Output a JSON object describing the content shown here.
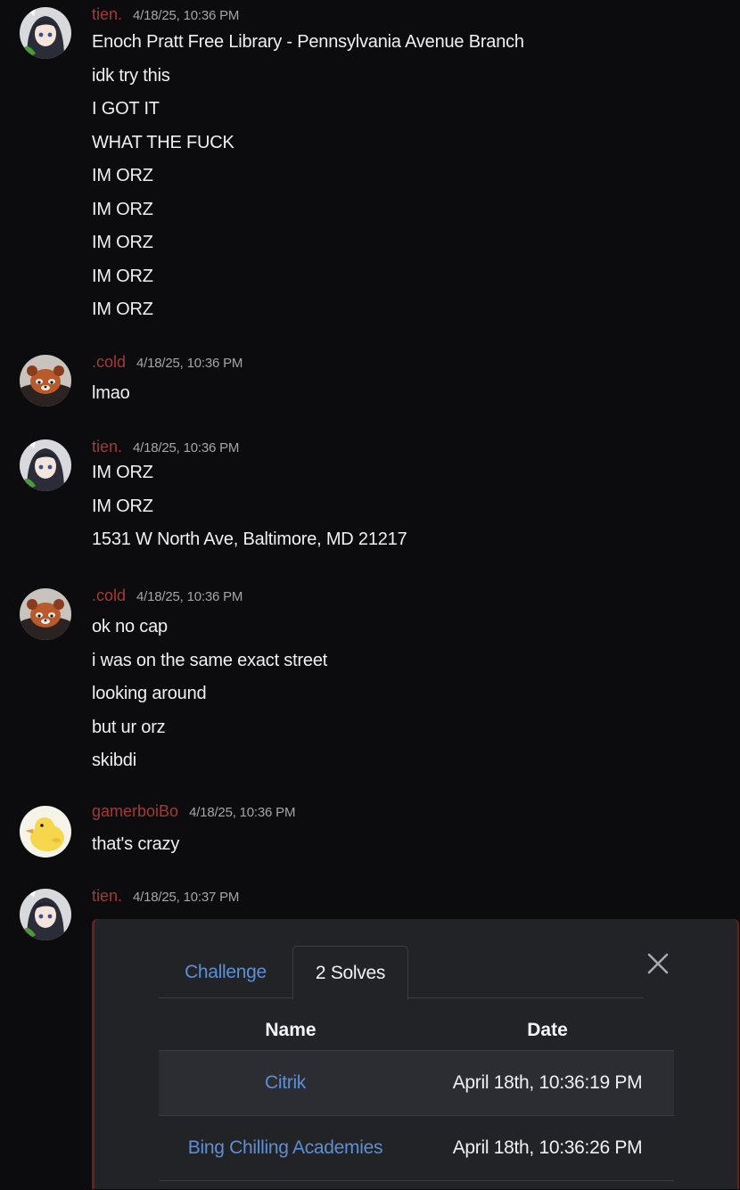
{
  "messages": [
    {
      "user": "tien.",
      "time": "4/18/25, 10:36 PM",
      "avatar": "anime-girl-avatar",
      "lines": [
        "Enoch Pratt Free Library - Pennsylvania Avenue Branch",
        "idk try this",
        "I GOT IT",
        "WHAT THE FUCK",
        "IM ORZ",
        "IM ORZ",
        "IM ORZ",
        "IM ORZ",
        "IM ORZ"
      ]
    },
    {
      "user": ".cold",
      "time": "4/18/25, 10:36 PM",
      "avatar": "red-panda-avatar",
      "lines": [
        "lmao"
      ]
    },
    {
      "user": "tien.",
      "time": "4/18/25, 10:36 PM",
      "avatar": "anime-girl-avatar",
      "lines": [
        "IM ORZ",
        "IM ORZ",
        "1531 W North Ave, Baltimore, MD 21217"
      ]
    },
    {
      "user": ".cold",
      "time": "4/18/25, 10:36 PM",
      "avatar": "red-panda-avatar",
      "lines": [
        "ok no cap",
        "i was on the same exact street",
        "looking around",
        "but ur orz",
        "skibdi"
      ]
    },
    {
      "user": "gamerboiBo",
      "time": "4/18/25, 10:36 PM",
      "avatar": "duck-avatar",
      "lines": [
        "that's crazy"
      ]
    },
    {
      "user": "tien.",
      "time": "4/18/25, 10:37 PM",
      "avatar": "anime-girl-avatar",
      "lines": []
    }
  ],
  "modal": {
    "tabs": [
      {
        "label": "Challenge",
        "active": false
      },
      {
        "label": "2 Solves",
        "active": true
      }
    ],
    "close_icon": "close-icon",
    "columns": [
      "Name",
      "Date"
    ],
    "rows": [
      {
        "name": "Citrik",
        "date": "April 18th, 10:36:19 PM"
      },
      {
        "name": "Bing Chilling Academies",
        "date": "April 18th, 10:36:26 PM"
      }
    ]
  },
  "colors": {
    "background": "#0c0c0e",
    "username": "#a33a36",
    "timestamp": "#a4a4ab",
    "link": "#5c8fd6",
    "modal_bg": "#222327",
    "row_stripe": "#2c2d32"
  }
}
